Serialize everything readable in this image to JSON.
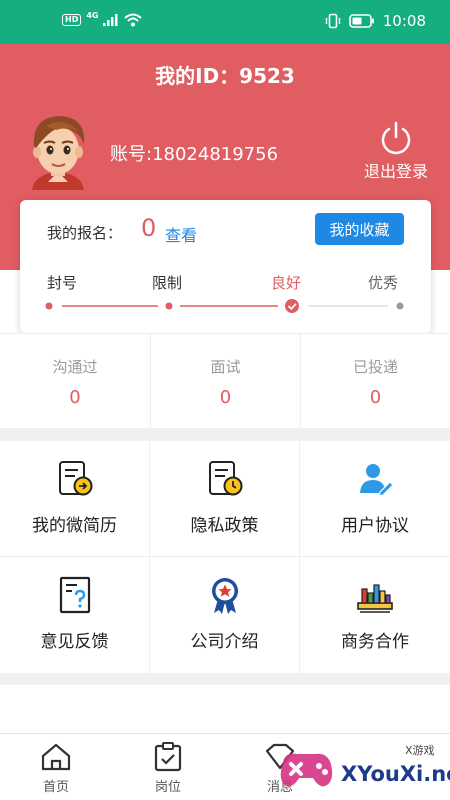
{
  "status_bar": {
    "time": "10:08",
    "hd_badge": "HD",
    "network": "4G"
  },
  "header": {
    "title": "我的ID：9523",
    "account": "账号:18024819756",
    "logout_label": "退出登录",
    "bg_color": "#e05d62"
  },
  "card": {
    "signup_label": "我的报名：",
    "signup_count": "0",
    "view_label": "查看",
    "favorites_label": "我的收藏",
    "levels": [
      "封号",
      "限制",
      "良好",
      "优秀"
    ],
    "active_level": "良好"
  },
  "stats": [
    {
      "label": "沟通过",
      "value": "0"
    },
    {
      "label": "面试",
      "value": "0"
    },
    {
      "label": "已投递",
      "value": "0"
    }
  ],
  "grid": [
    {
      "label": "我的微简历",
      "icon": "resume-icon"
    },
    {
      "label": "隐私政策",
      "icon": "privacy-policy-icon"
    },
    {
      "label": "用户协议",
      "icon": "user-agreement-icon"
    },
    {
      "label": "意见反馈",
      "icon": "feedback-icon"
    },
    {
      "label": "公司介绍",
      "icon": "company-badge-icon"
    },
    {
      "label": "商务合作",
      "icon": "business-icon"
    }
  ],
  "tabs": [
    {
      "label": "首页",
      "icon": "home-icon"
    },
    {
      "label": "岗位",
      "icon": "clipboard-icon"
    },
    {
      "label": "消息",
      "icon": "message-icon"
    }
  ],
  "watermark": {
    "text": "XYouXi.net",
    "small": "X游戏"
  },
  "colors": {
    "status_bar": "#15ae81",
    "accent": "#e05d62",
    "link": "#1e88e5"
  }
}
